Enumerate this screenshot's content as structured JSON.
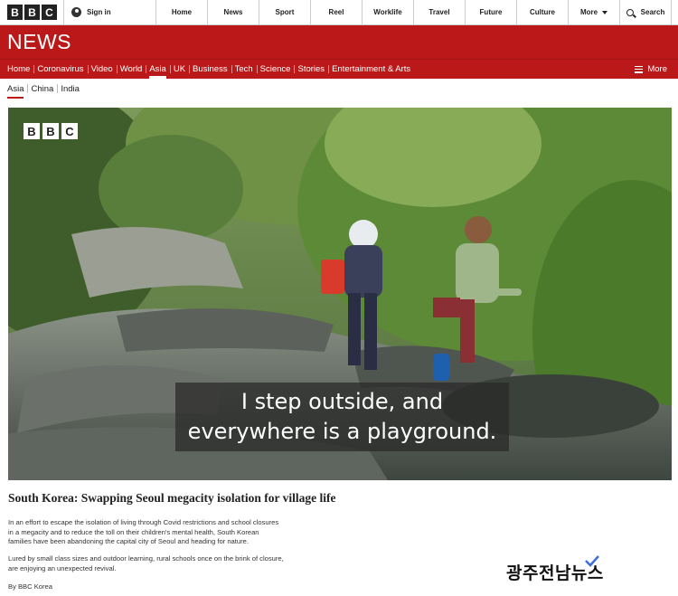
{
  "bbc_logo": {
    "letters": [
      "B",
      "B",
      "C"
    ]
  },
  "topbar": {
    "signin_label": "Sign in",
    "nav": [
      "Home",
      "News",
      "Sport",
      "Reel",
      "Worklife",
      "Travel",
      "Future",
      "Culture"
    ],
    "more_label": "More",
    "search_label": "Search"
  },
  "news_wordmark": "NEWS",
  "section_nav": {
    "items": [
      "Home",
      "Coronavirus",
      "Video",
      "World",
      "Asia",
      "UK",
      "Business",
      "Tech",
      "Science",
      "Stories",
      "Entertainment & Arts"
    ],
    "active": "Asia",
    "more_label": "More"
  },
  "sub_nav": {
    "items": [
      "Asia",
      "China",
      "India"
    ],
    "active": "Asia"
  },
  "video": {
    "logo_letters": [
      "B",
      "B",
      "C"
    ],
    "subtitle_line1": "I step outside, and",
    "subtitle_line2": "everywhere is a playground."
  },
  "article": {
    "headline": "South Korea: Swapping Seoul megacity isolation for village life",
    "paragraph1_line1": "In an effort to escape the isolation of living through Covid restrictions and school closures",
    "paragraph1_line2": "in a megacity and to reduce the toll on their children's mental health, South Korean",
    "paragraph1_line3": "families have been abandoning the capital city of Seoul and heading for nature.",
    "paragraph2_line1": "Lured by small class sizes and outdoor learning, rural schools once on the brink of closure,",
    "paragraph2_line2": "are enjoying an unexpected revival.",
    "byline": "By BBC Korea"
  },
  "watermark": "광주전남뉴스",
  "colors": {
    "brand_red": "#bb1919",
    "dark": "#222222",
    "accent_check": "#3d6fd6"
  }
}
